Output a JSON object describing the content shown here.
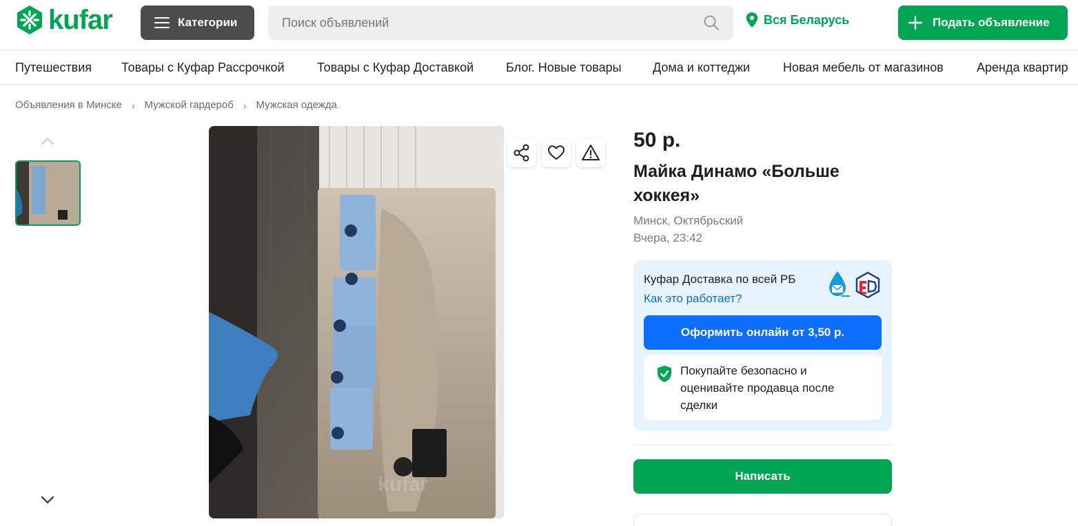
{
  "header": {
    "logo_text": "kufar",
    "categories_label": "Категории",
    "search_placeholder": "Поиск объявлений",
    "region": "Вся Беларусь",
    "post_label": "Подать объявление"
  },
  "nav": {
    "items": [
      "Путешествия",
      "Товары с Куфар Рассрочкой",
      "Товары с Куфар Доставкой",
      "Блог. Новые товары",
      "Дома и коттеджи",
      "Новая мебель от магазинов",
      "Аренда квартир"
    ]
  },
  "breadcrumb": {
    "items": [
      "Объявления в Минске",
      "Мужской гардероб",
      "Мужская одежда"
    ],
    "separator": "›"
  },
  "listing": {
    "price": "50 р.",
    "title": "Майка Динамо «Больше хоккея»",
    "location": "Минск, Октябрьский",
    "date": "Вчера, 23:42"
  },
  "delivery": {
    "title": "Куфар Доставка по всей РБ",
    "link": "Как это работает?",
    "order_label": "Оформить онлайн от 3,50 р.",
    "safe_text": "Покупайте безопасно и оценивайте продавца после сделки"
  },
  "actions": {
    "write_label": "Написать"
  },
  "image": {
    "watermark": "kufar"
  },
  "colors": {
    "brand_green": "#00a554",
    "dark_button": "#4c4c4c",
    "blue_button": "#0d6efd",
    "link_blue": "#0b6ed4",
    "delivery_bg": "#e7f3fd"
  }
}
